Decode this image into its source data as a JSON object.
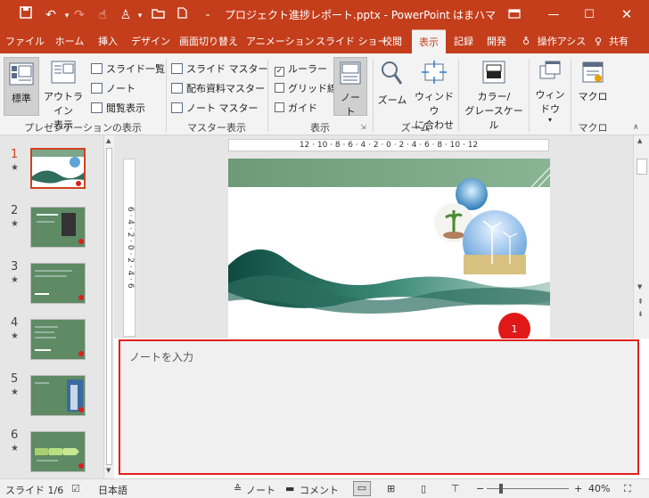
{
  "title_bar": {
    "file_title": "プロジェクト進捗レポート.pptx  -  PowerPoint",
    "user": "はまハマ",
    "colors": {
      "accent": "#c43e1c"
    }
  },
  "tabs": [
    "ファイル",
    "ホーム",
    "挿入",
    "デザイン",
    "画面切り替え",
    "アニメーション",
    "スライド ショー",
    "校閲",
    "表示",
    "記録",
    "開発",
    "操作アシス",
    "共有"
  ],
  "ribbon": {
    "presentation_views": {
      "normal": "標準",
      "outline": [
        "アウトライン",
        "表示"
      ],
      "slide_sorter": "スライド一覧",
      "notes_page": "ノート",
      "reading": "閲覧表示",
      "label": "プレゼンテーションの表示"
    },
    "master_views": {
      "slide_master": "スライド マスター",
      "handout_master": "配布資料マスター",
      "notes_master": "ノート マスター",
      "label": "マスター表示"
    },
    "show": {
      "ruler": "ルーラー",
      "gridlines": "グリッド線",
      "guides": "ガイド",
      "notes_button": [
        "ノー",
        "ト"
      ],
      "label": "表示"
    },
    "zoom": {
      "zoom": "ズーム",
      "fit": [
        "ウィンドウ",
        "に合わせる"
      ],
      "label": "ズーム"
    },
    "color": [
      "カラー/",
      "グレースケール"
    ],
    "window": "ウィンドウ",
    "macro": {
      "button": "マクロ",
      "label": "マクロ"
    }
  },
  "ruler": {
    "horizontal": "12 · 10 · 8 · 6 · 4 · 2 · 0 · 2 · 4 · 6 · 8 · 10 · 12",
    "vertical": "6 · 4 · 2 · 0 · 2 · 4 · 6"
  },
  "slides": [
    {
      "num": "1",
      "star": "★"
    },
    {
      "num": "2",
      "star": "★"
    },
    {
      "num": "3",
      "star": "★"
    },
    {
      "num": "4",
      "star": "★"
    },
    {
      "num": "5",
      "star": "★"
    },
    {
      "num": "6",
      "star": "★"
    }
  ],
  "slide_badge": "1",
  "notes_placeholder": "ノートを入力",
  "status": {
    "slide": "スライド 1/6",
    "language": "日本語",
    "notes": "ノート",
    "comments": "コメント",
    "zoom": "40%"
  }
}
